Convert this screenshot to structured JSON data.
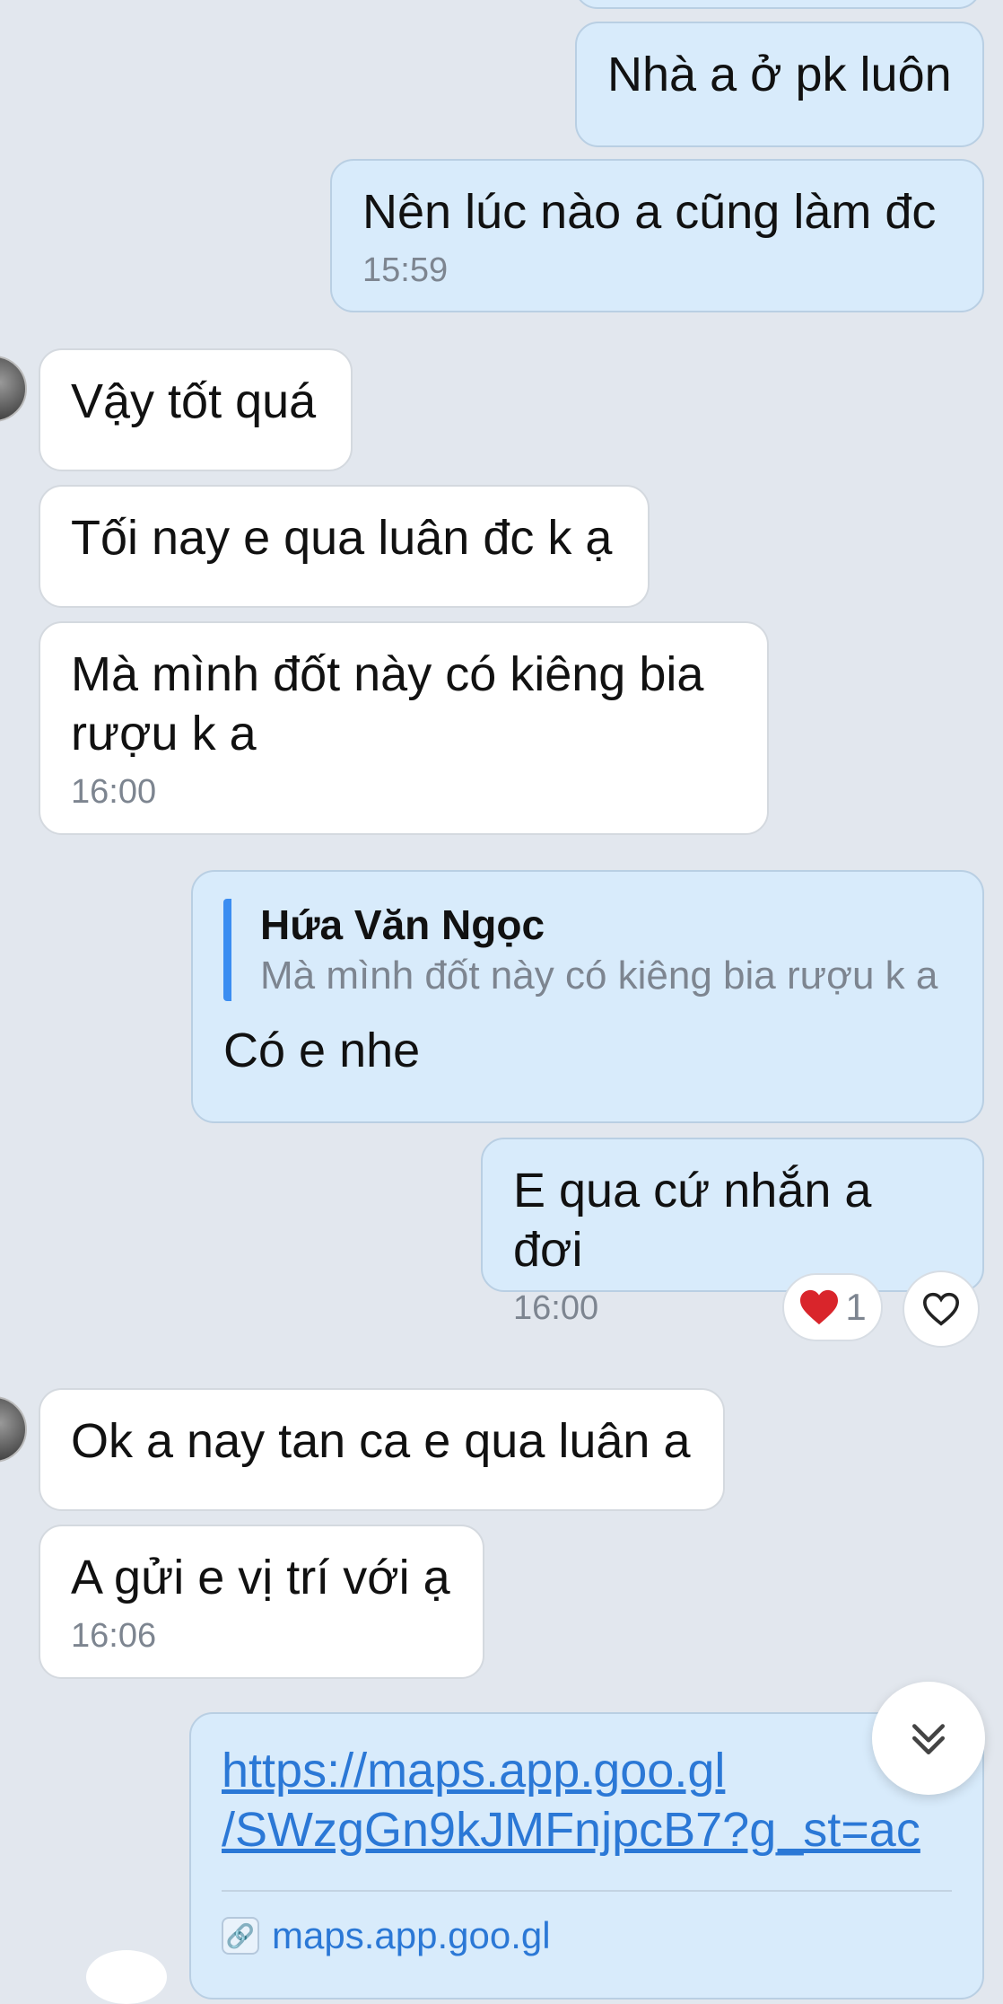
{
  "messages": {
    "m1": {
      "text": "Nhà a ở pk luôn"
    },
    "m2": {
      "text": "Nên lúc nào a cũng làm đc",
      "time": "15:59"
    },
    "m3": {
      "text": "Vậy tốt quá"
    },
    "m4": {
      "text": "Tối nay e qua luân đc k ạ"
    },
    "m5": {
      "line1": "Mà mình đốt này có kiêng bia",
      "line2": "rượu k a",
      "time": "16:00"
    },
    "m6": {
      "quote_name": "Hứa Văn Ngọc",
      "quote_text": "Mà mình đốt này có kiêng bia rượu k a",
      "text": "Có e nhe"
    },
    "m7": {
      "text": "E qua cứ nhắn a đơi",
      "time": "16:00",
      "reaction_count": "1"
    },
    "m8": {
      "text": "Ok a nay tan ca e qua luân a"
    },
    "m9": {
      "text": "A gửi e vị trí với ạ",
      "time": "16:06"
    },
    "m10": {
      "link_line1": "https://maps.app.goo.gl",
      "link_line2": "/SWzgGn9kJMFnjpcB7?g_st=ac",
      "preview_domain": "maps.app.goo.gl"
    }
  },
  "icons": {
    "heart": "heart-icon",
    "scroll": "double-chevron-down-icon",
    "link": "link-icon"
  },
  "colors": {
    "incoming": "#ffffff",
    "outgoing": "#d8ebfb",
    "accent": "#3b8df1",
    "link": "#2b78d6",
    "background": "#e2e7ee"
  }
}
